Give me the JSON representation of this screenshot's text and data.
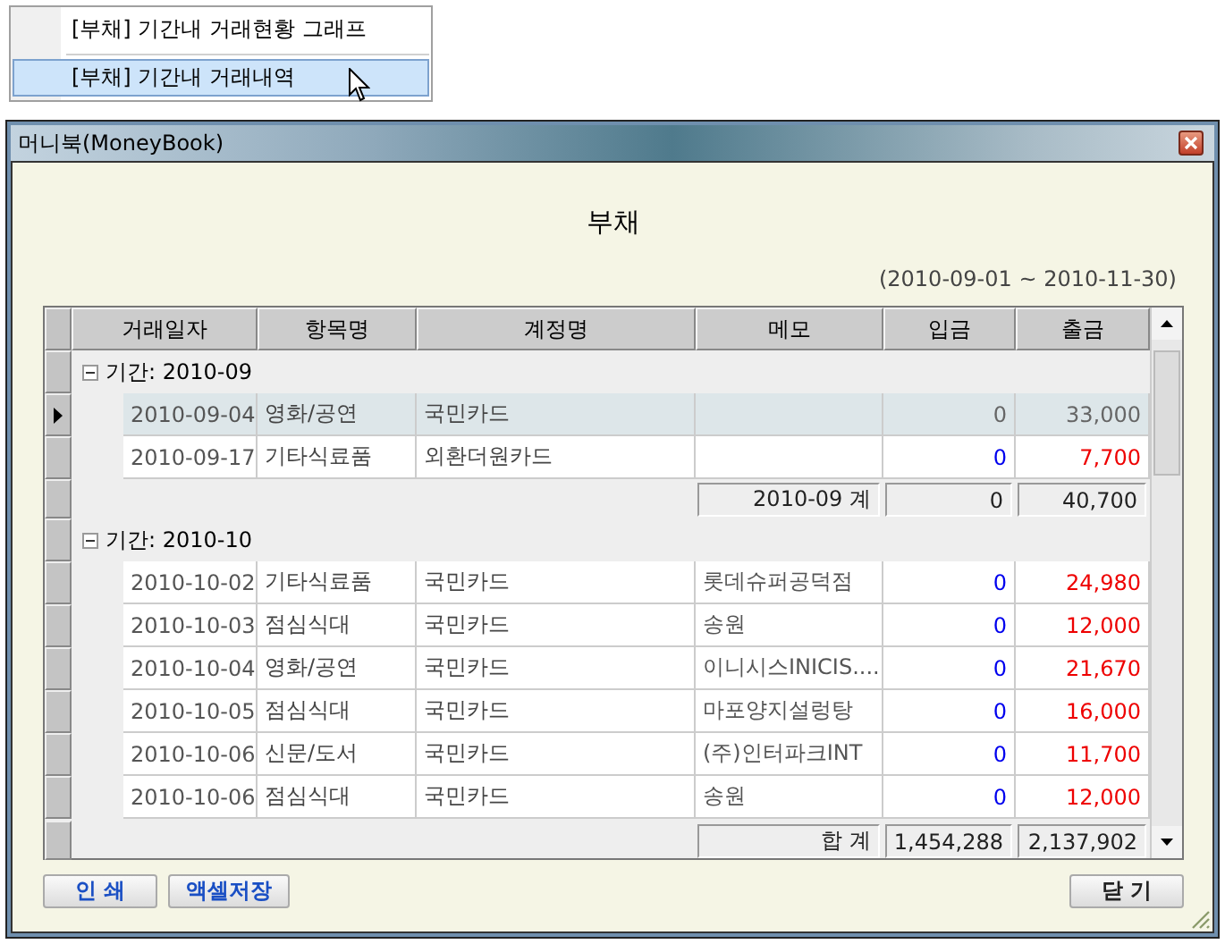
{
  "menu": {
    "items": [
      {
        "label": "[부채] 기간내 거래현황 그래프",
        "selected": false
      },
      {
        "label": "[부채] 기간내 거래내역",
        "selected": true
      }
    ]
  },
  "window": {
    "title": "머니북(MoneyBook)"
  },
  "report": {
    "title": "부채",
    "period": "(2010-09-01 ~ 2010-11-30)"
  },
  "table": {
    "columns": [
      "거래일자",
      "항목명",
      "계정명",
      "메모",
      "입금",
      "출금"
    ],
    "groups": [
      {
        "label": "기간: 2010-09",
        "expanded": true,
        "rows": [
          {
            "date": "2010-09-04",
            "category": "영화/공연",
            "account": "국민카드",
            "deposit": "0",
            "withdrawal": "33,000",
            "selected": true
          },
          {
            "date": "2010-09-17",
            "category": "기타식료품",
            "account": "외환더원카드",
            "deposit": "0",
            "withdrawal": "7,700",
            "selected": false
          }
        ],
        "subtotal": {
          "label": "2010-09 계",
          "deposit": "0",
          "withdrawal": "40,700"
        }
      },
      {
        "label": "기간: 2010-10",
        "expanded": true,
        "rows": [
          {
            "date": "2010-10-02",
            "category": "기타식료품",
            "account": "국민카드",
            "memo": "롯데슈퍼공덕점",
            "deposit": "0",
            "withdrawal": "24,980",
            "selected": false
          },
          {
            "date": "2010-10-03",
            "category": "점심식대",
            "account": "국민카드",
            "memo": "송원",
            "deposit": "0",
            "withdrawal": "12,000",
            "selected": false
          },
          {
            "date": "2010-10-04",
            "category": "영화/공연",
            "account": "국민카드",
            "memo": "이니시스INICIS....",
            "deposit": "0",
            "withdrawal": "21,670",
            "selected": false
          },
          {
            "date": "2010-10-05",
            "category": "점심식대",
            "account": "국민카드",
            "memo": "마포양지설렁탕",
            "deposit": "0",
            "withdrawal": "16,000",
            "selected": false
          },
          {
            "date": "2010-10-06",
            "category": "신문/도서",
            "account": "국민카드",
            "memo": "(주)인터파크INT",
            "deposit": "0",
            "withdrawal": "11,700",
            "selected": false
          },
          {
            "date": "2010-10-06",
            "category": "점심식대",
            "account": "국민카드",
            "memo": "송원",
            "deposit": "0",
            "withdrawal": "12,000",
            "selected": false
          }
        ]
      }
    ],
    "total": {
      "label": "합 계",
      "deposit": "1,454,288",
      "withdrawal": "2,137,902"
    }
  },
  "buttons": {
    "left": [
      "인 쇄",
      "액셀저장"
    ],
    "right": [
      "닫 기"
    ]
  }
}
